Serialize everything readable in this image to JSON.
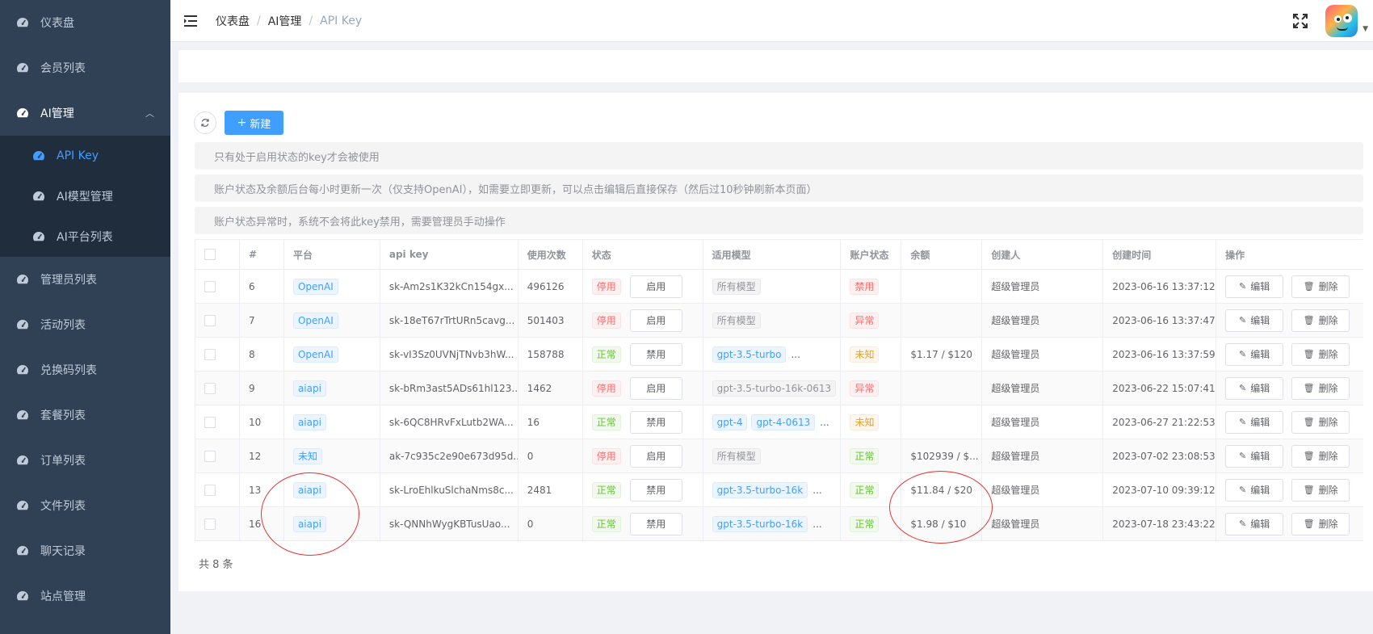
{
  "sidebar": {
    "items": [
      {
        "label": "仪表盘"
      },
      {
        "label": "会员列表"
      },
      {
        "label": "AI管理",
        "expanded": true,
        "children": [
          {
            "label": "API Key",
            "active": true
          },
          {
            "label": "AI模型管理"
          },
          {
            "label": "AI平台列表"
          }
        ]
      },
      {
        "label": "管理员列表"
      },
      {
        "label": "活动列表"
      },
      {
        "label": "兑换码列表"
      },
      {
        "label": "套餐列表"
      },
      {
        "label": "订单列表"
      },
      {
        "label": "文件列表"
      },
      {
        "label": "聊天记录"
      },
      {
        "label": "站点管理"
      }
    ]
  },
  "breadcrumb": [
    "仪表盘",
    "AI管理",
    "API Key"
  ],
  "toolbar": {
    "new_label": "新建"
  },
  "alerts": [
    "只有处于启用状态的key才会被使用",
    "账户状态及余额后台每小时更新一次（仅支持OpenAI），如需要立即更新，可以点击编辑后直接保存（然后过10秒钟刷新本页面）",
    "账户状态异常时，系统不会将此key禁用，需要管理员手动操作"
  ],
  "table": {
    "columns": [
      "#",
      "平台",
      "api key",
      "使用次数",
      "状态",
      "适用模型",
      "账户状态",
      "余额",
      "创建人",
      "创建时间",
      "操作"
    ],
    "edit_label": "编辑",
    "delete_label": "删除",
    "rows": [
      {
        "id": "6",
        "platform": "OpenAI",
        "key": "sk-Am2s1K32kCn154gx...",
        "count": "496126",
        "status": "停用",
        "status_btn": "启用",
        "models": [
          "所有模型"
        ],
        "models_more": false,
        "models_gray": true,
        "acct": "禁用",
        "acct_color": "red",
        "balance": "",
        "creator": "超级管理员",
        "time": "2023-06-16 13:37:12"
      },
      {
        "id": "7",
        "platform": "OpenAI",
        "key": "sk-18eT67rTrtURn5cavg...",
        "count": "501403",
        "status": "停用",
        "status_btn": "启用",
        "models": [
          "所有模型"
        ],
        "models_more": false,
        "models_gray": true,
        "acct": "异常",
        "acct_color": "red",
        "balance": "",
        "creator": "超级管理员",
        "time": "2023-06-16 13:37:47"
      },
      {
        "id": "8",
        "platform": "OpenAI",
        "key": "sk-vI3Sz0UVNjTNvb3hW...",
        "count": "158788",
        "status": "正常",
        "status_btn": "禁用",
        "models": [
          "gpt-3.5-turbo"
        ],
        "models_more": true,
        "models_gray": false,
        "acct": "未知",
        "acct_color": "orange",
        "balance": "$1.17 / $120",
        "creator": "超级管理员",
        "time": "2023-06-16 13:37:59"
      },
      {
        "id": "9",
        "platform": "aiapi",
        "key": "sk-bRm3ast5ADs61hl123...",
        "count": "1462",
        "status": "停用",
        "status_btn": "启用",
        "models": [
          "gpt-3.5-turbo-16k-0613"
        ],
        "models_more": true,
        "models_gray": true,
        "acct": "异常",
        "acct_color": "red",
        "balance": "",
        "creator": "超级管理员",
        "time": "2023-06-22 15:07:41"
      },
      {
        "id": "10",
        "platform": "aiapi",
        "key": "sk-6QC8HRvFxLutb2WA...",
        "count": "16",
        "status": "正常",
        "status_btn": "禁用",
        "models": [
          "gpt-4",
          "gpt-4-0613"
        ],
        "models_more": true,
        "models_gray": false,
        "acct": "未知",
        "acct_color": "orange",
        "balance": "",
        "creator": "超级管理员",
        "time": "2023-06-27 21:22:53"
      },
      {
        "id": "12",
        "platform": "未知",
        "key": "ak-7c935c2e90e673d95d...",
        "count": "0",
        "status": "停用",
        "status_btn": "启用",
        "models": [
          "所有模型"
        ],
        "models_more": false,
        "models_gray": true,
        "acct": "正常",
        "acct_color": "green",
        "balance": "$102939 / $...",
        "creator": "超级管理员",
        "time": "2023-07-02 23:08:53"
      },
      {
        "id": "13",
        "platform": "aiapi",
        "key": "sk-LroEhlkuSlchaNms8c...",
        "count": "2481",
        "status": "正常",
        "status_btn": "禁用",
        "models": [
          "gpt-3.5-turbo-16k"
        ],
        "models_more": true,
        "models_gray": false,
        "acct": "正常",
        "acct_color": "green",
        "balance": "$11.84 / $20",
        "creator": "超级管理员",
        "time": "2023-07-10 09:39:12"
      },
      {
        "id": "16",
        "platform": "aiapi",
        "key": "sk-QNNhWygKBTusUao...",
        "count": "0",
        "status": "正常",
        "status_btn": "禁用",
        "models": [
          "gpt-3.5-turbo-16k"
        ],
        "models_more": true,
        "models_gray": false,
        "acct": "正常",
        "acct_color": "green",
        "balance": "$1.98 / $10",
        "creator": "超级管理员",
        "time": "2023-07-18 23:43:22"
      }
    ]
  },
  "total_label": "共 8 条",
  "colors": {
    "primary": "#409eff",
    "sidebar_bg": "#304156",
    "annotation": "#e3342f"
  }
}
